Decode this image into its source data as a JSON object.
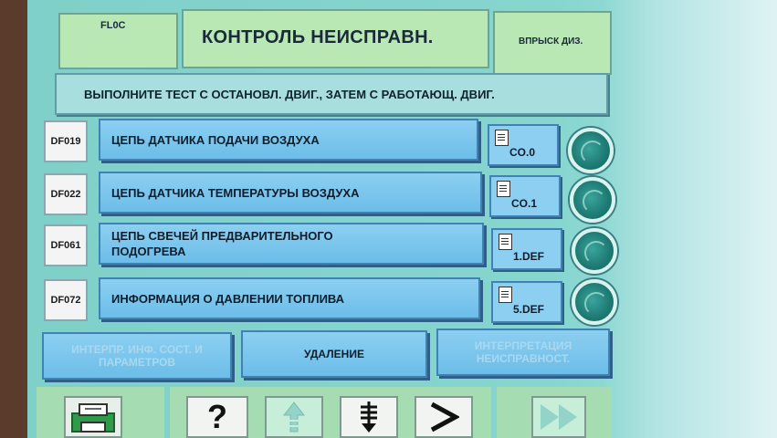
{
  "header": {
    "left_label": "FL0C",
    "title": "КОНТРОЛЬ НЕИСПРАВН.",
    "right_label": "ВПРЫСК ДИЗ."
  },
  "instruction": "ВЫПОЛНИТЕ ТЕСТ С ОСТАНОВЛ. ДВИГ., ЗАТЕМ С РАБОТАЮЩ. ДВИГ.",
  "faults": [
    {
      "code": "DF019",
      "description": "ЦЕПЬ ДАТЧИКА ПОДАЧИ ВОЗДУХА",
      "status": "CO.0"
    },
    {
      "code": "DF022",
      "description": "ЦЕПЬ ДАТЧИКА ТЕМПЕРАТУРЫ ВОЗДУХА",
      "status": "CO.1"
    },
    {
      "code": "DF061",
      "description": "ЦЕПЬ СВЕЧЕЙ ПРЕДВАРИТЕЛЬНОГО ПОДОГРЕВА",
      "status": "1.DEF"
    },
    {
      "code": "DF072",
      "description": "ИНФОРМАЦИЯ О ДАВЛЕНИИ ТОПЛИВА",
      "status": "5.DEF"
    }
  ],
  "actions": {
    "left": "ИНТЕРПР. ИНФ. СОСТ. И ПАРАМЕТРОВ",
    "middle": "УДАЛЕНИЕ",
    "right": "ИНТЕРПРЕТАЦИЯ НЕИСПРАВНОСТ."
  },
  "toolbar": {
    "help_label": "?"
  },
  "icons": [
    "printer-icon",
    "help-icon",
    "arrow-up-icon",
    "arrow-down-stop-icon",
    "chevron-right-icon",
    "fast-forward-icon",
    "document-icon",
    "status-led-icon"
  ],
  "colors": {
    "panel_green": "#b9e8b5",
    "button_blue": "#8ccff1",
    "led_teal": "#1f7d76",
    "background": "#86d6cf"
  }
}
